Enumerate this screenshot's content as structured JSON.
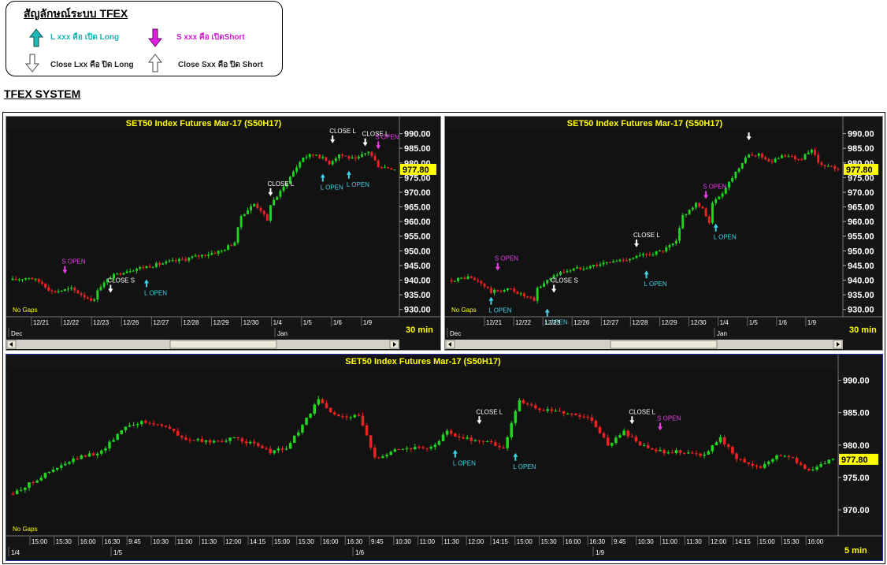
{
  "legend": {
    "title": "สัญลักษณ์ระบบ TFEX",
    "long_open": "L xxx คือ เปิด Long",
    "short_open": "S xxx คือ เปิดShort",
    "long_close": "Close Lxx คือ ปิด Long",
    "short_close": "Close Sxx คือ ปิด Short",
    "colors": {
      "long_open": "#1ab3b3",
      "short_open": "#e020e0",
      "close": "#ffffff"
    }
  },
  "system_title": "TFEX SYSTEM",
  "chart_data": [
    {
      "type": "candlestick",
      "title": "SET50  Index  Futures  Mar-17  (S50H17)",
      "timeframe": "30  min",
      "gaps_label": "No Gaps",
      "y_ticks": [
        "990.00",
        "985.00",
        "980.00",
        "975.00",
        "970.00",
        "965.00",
        "960.00",
        "955.00",
        "950.00",
        "945.00",
        "940.00",
        "935.00",
        "930.00"
      ],
      "ylim": [
        927.5,
        991.5
      ],
      "last_price": "977.80",
      "x_labels": [
        "12/21",
        "12/22",
        "12/23",
        "12/26",
        "12/27",
        "12/28",
        "12/29",
        "12/30",
        "1/4",
        "1/5",
        "1/6",
        "1/9"
      ],
      "month_labels": [
        "Dec",
        "Jan"
      ],
      "path": [
        [
          0,
          940
        ],
        [
          5,
          941
        ],
        [
          9,
          939
        ],
        [
          12,
          936
        ],
        [
          18,
          937
        ],
        [
          22,
          934.5
        ],
        [
          25,
          933
        ],
        [
          26,
          937
        ],
        [
          30,
          941
        ],
        [
          34,
          943
        ],
        [
          38,
          944
        ],
        [
          45,
          945.5
        ],
        [
          52,
          947
        ],
        [
          58,
          948.5
        ],
        [
          64,
          950
        ],
        [
          68,
          953
        ],
        [
          70,
          962
        ],
        [
          74,
          966
        ],
        [
          76,
          964
        ],
        [
          78,
          960
        ],
        [
          79,
          966
        ],
        [
          82,
          970
        ],
        [
          86,
          977
        ],
        [
          89,
          982
        ],
        [
          93,
          983
        ],
        [
          97,
          980
        ],
        [
          100,
          983
        ],
        [
          105,
          981
        ],
        [
          109,
          984
        ],
        [
          112,
          979
        ],
        [
          117,
          978
        ]
      ],
      "signals": [
        {
          "kind": "short_open",
          "label": "S  OPEN",
          "x": 16,
          "price": 939.5
        },
        {
          "kind": "close",
          "label": "CLOSE  S",
          "x": 30,
          "price": 933
        },
        {
          "kind": "long_open",
          "label": "L  OPEN",
          "x": 41,
          "price": 943
        },
        {
          "kind": "close",
          "label": "CLOSE  L",
          "x": 79,
          "price": 966
        },
        {
          "kind": "close",
          "label": "CLOSE  L",
          "x": 98,
          "price": 984
        },
        {
          "kind": "long_open",
          "label": "L  OPEN",
          "x": 95,
          "price": 979
        },
        {
          "kind": "long_open",
          "label": "L  OPEN",
          "x": 103,
          "price": 980
        },
        {
          "kind": "close",
          "label": "CLOSE  L",
          "x": 108,
          "price": 983
        },
        {
          "kind": "short_open",
          "label": "S  OPEN",
          "x": 112,
          "price": 982
        }
      ]
    },
    {
      "type": "candlestick",
      "title": "SET50  Index  Futures  Mar-17  (S50H17)",
      "timeframe": "30  min",
      "gaps_label": "No Gaps",
      "y_ticks": [
        "990.00",
        "985.00",
        "980.00",
        "975.00",
        "970.00",
        "965.00",
        "960.00",
        "955.00",
        "950.00",
        "945.00",
        "940.00",
        "935.00",
        "930.00"
      ],
      "ylim": [
        927.5,
        991.5
      ],
      "last_price": "977.80",
      "x_labels": [
        "12/21",
        "12/22",
        "12/23",
        "12/26",
        "12/27",
        "12/28",
        "12/29",
        "12/30",
        "1/4",
        "1/5",
        "1/6",
        "1/9"
      ],
      "month_labels": [
        "Dec",
        "Jan"
      ],
      "path": [
        [
          0,
          940
        ],
        [
          5,
          941
        ],
        [
          9,
          939
        ],
        [
          12,
          936
        ],
        [
          18,
          937
        ],
        [
          22,
          934.5
        ],
        [
          25,
          933
        ],
        [
          26,
          937
        ],
        [
          30,
          941
        ],
        [
          34,
          943
        ],
        [
          38,
          944
        ],
        [
          45,
          945.5
        ],
        [
          52,
          947
        ],
        [
          58,
          948.5
        ],
        [
          64,
          950
        ],
        [
          68,
          953
        ],
        [
          70,
          962
        ],
        [
          74,
          966
        ],
        [
          76,
          964
        ],
        [
          78,
          960
        ],
        [
          79,
          966
        ],
        [
          82,
          970
        ],
        [
          86,
          977
        ],
        [
          89,
          982
        ],
        [
          93,
          983
        ],
        [
          97,
          980
        ],
        [
          100,
          983
        ],
        [
          105,
          981
        ],
        [
          109,
          984
        ],
        [
          112,
          979
        ],
        [
          117,
          978
        ]
      ],
      "signals": [
        {
          "kind": "short_open",
          "label": "S  OPEN",
          "x": 14,
          "price": 940.5
        },
        {
          "kind": "long_open",
          "label": "L  OPEN",
          "x": 12,
          "price": 937
        },
        {
          "kind": "long_open",
          "label": "L  OPEN",
          "x": 29,
          "price": 933
        },
        {
          "kind": "close",
          "label": "CLOSE  S",
          "x": 31,
          "price": 933
        },
        {
          "kind": "close",
          "label": "CLOSE  L",
          "x": 56,
          "price": 948.5
        },
        {
          "kind": "long_open",
          "label": "L  OPEN",
          "x": 59,
          "price": 946
        },
        {
          "kind": "short_open",
          "label": "S  OPEN",
          "x": 77,
          "price": 965
        },
        {
          "kind": "long_open",
          "label": "L  OPEN",
          "x": 80,
          "price": 962
        },
        {
          "kind": "close",
          "label": "",
          "x": 90,
          "price": 985
        }
      ]
    },
    {
      "type": "candlestick",
      "title": "SET50  Index  Futures  Mar-17  (S50H17)",
      "timeframe": "5  min",
      "gaps_label": "No Gaps",
      "y_ticks": [
        "990.00",
        "985.00",
        "980.00",
        "975.00",
        "970.00"
      ],
      "ylim": [
        966,
        992
      ],
      "last_price": "977.80",
      "x_labels": [
        "15:00",
        "15:30",
        "16:00",
        "16:30",
        "9:45",
        "10:30",
        "11:00",
        "11:30",
        "12:00",
        "14:15",
        "15:00",
        "15:30",
        "16:00",
        "16:30",
        "9:45",
        "10:30",
        "11:00",
        "11:30",
        "12:00",
        "14:15",
        "15:00",
        "15:30",
        "16:00",
        "16:30",
        "9:45",
        "10:30",
        "11:00",
        "11:30",
        "12:00",
        "14:15",
        "15:00",
        "15:30",
        "16:00"
      ],
      "month_labels": [
        "1/4",
        "1/5",
        "1/6",
        "1/9"
      ],
      "path": [
        [
          0,
          972.5
        ],
        [
          8,
          975.5
        ],
        [
          16,
          978
        ],
        [
          22,
          979
        ],
        [
          28,
          983
        ],
        [
          32,
          983.5
        ],
        [
          38,
          983
        ],
        [
          42,
          981
        ],
        [
          48,
          980.5
        ],
        [
          56,
          981
        ],
        [
          60,
          980
        ],
        [
          64,
          979
        ],
        [
          68,
          979.5
        ],
        [
          72,
          983
        ],
        [
          76,
          987
        ],
        [
          80,
          984.5
        ],
        [
          86,
          984.5
        ],
        [
          90,
          978
        ],
        [
          96,
          979.5
        ],
        [
          104,
          979.5
        ],
        [
          108,
          982
        ],
        [
          112,
          981
        ],
        [
          118,
          980.5
        ],
        [
          122,
          979.5
        ],
        [
          126,
          987
        ],
        [
          130,
          985.5
        ],
        [
          138,
          985
        ],
        [
          144,
          984
        ],
        [
          148,
          980
        ],
        [
          152,
          982
        ],
        [
          156,
          980
        ],
        [
          160,
          979
        ],
        [
          166,
          979
        ],
        [
          172,
          978.5
        ],
        [
          176,
          981
        ],
        [
          180,
          978
        ],
        [
          186,
          976.5
        ],
        [
          190,
          978.5
        ],
        [
          194,
          978
        ],
        [
          198,
          976
        ],
        [
          204,
          977.8
        ]
      ],
      "signals": [
        {
          "kind": "long_open",
          "label": "L  OPEN",
          "x": 110,
          "price": 980.5
        },
        {
          "kind": "close",
          "label": "CLOSE  L",
          "x": 116,
          "price": 982
        },
        {
          "kind": "long_open",
          "label": "L  OPEN",
          "x": 125,
          "price": 980
        },
        {
          "kind": "close",
          "label": "CLOSE  L",
          "x": 154,
          "price": 982
        },
        {
          "kind": "short_open",
          "label": "S  OPEN",
          "x": 161,
          "price": 981
        }
      ]
    }
  ]
}
